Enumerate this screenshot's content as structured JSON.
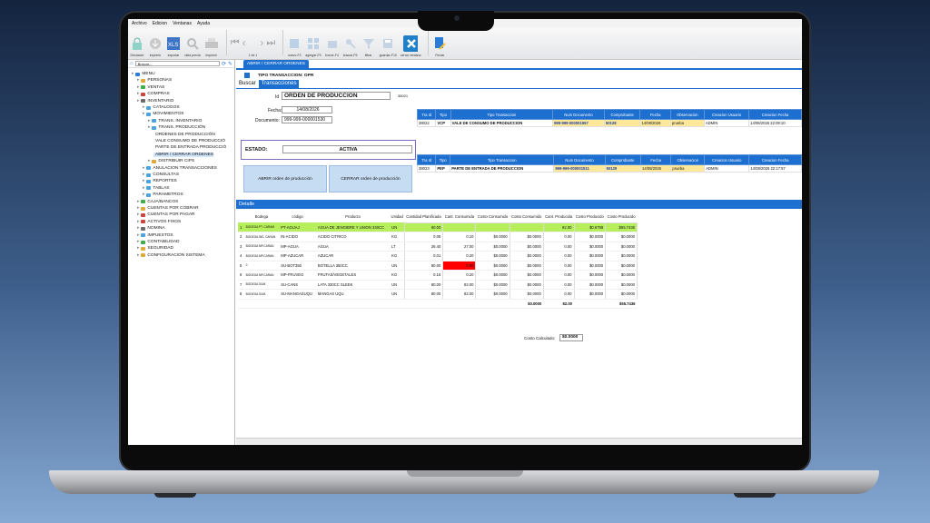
{
  "menu": [
    "Archivo",
    "Edicion",
    "Ventanas",
    "Ayuda"
  ],
  "toolbar": {
    "deshacer": "Deshacer",
    "imprimir": "imprimir",
    "exportar": "exportar",
    "vista_previa": "vista previa",
    "imprimir2": "imprimir",
    "page": "1 de 1",
    "nuevo": "nuevo-F2",
    "agregar": "agregar-F3",
    "borrar": "borrar-F4",
    "buscar": "buscar-F5",
    "filtrar": "filtrar",
    "guardar": "guardar-F10",
    "cerrar": "cerrar ventana",
    "firmar": "Firmar"
  },
  "search": {
    "placeholder": "Buscar..."
  },
  "tree": [
    {
      "label": "MENU",
      "depth": 0,
      "color": "#2b7bd8"
    },
    {
      "label": "PERSONAS",
      "depth": 1,
      "color": "#e0a93b"
    },
    {
      "label": "VENTAS",
      "depth": 1,
      "color": "#3fae4a"
    },
    {
      "label": "COMPRAS",
      "depth": 1,
      "color": "#c8463b"
    },
    {
      "label": "INVENTARIO",
      "depth": 1,
      "color": "#6b6b6b"
    },
    {
      "label": "CATALOGOS",
      "depth": 2,
      "color": "#4aa3df"
    },
    {
      "label": "MOVIMIENTOS",
      "depth": 2,
      "color": "#4aa3df"
    },
    {
      "label": "TRANS. INVENTARIO",
      "depth": 3,
      "color": "#4aa3df"
    },
    {
      "label": "TRANS. PRODUCCIÓN",
      "depth": 3,
      "color": "#4aa3df"
    },
    {
      "label": "ORDENES DE PRODUCCIÓN",
      "depth": 4,
      "color": ""
    },
    {
      "label": "VALE CONSUMO DE PRODUCCIÓ",
      "depth": 4,
      "color": ""
    },
    {
      "label": "PARTE DE ENTRADA PRODUCCIÓ",
      "depth": 4,
      "color": ""
    },
    {
      "label": "ABRIR / CERRAR ORDENES",
      "depth": 4,
      "color": "",
      "selected": true
    },
    {
      "label": "DISTRIBUIR CIPS",
      "depth": 3,
      "color": "#e0a93b"
    },
    {
      "label": "ANULACION TRANSACCIONES",
      "depth": 2,
      "color": "#4aa3df"
    },
    {
      "label": "CONSULTAS",
      "depth": 2,
      "color": "#4aa3df"
    },
    {
      "label": "REPORTES",
      "depth": 2,
      "color": "#4aa3df"
    },
    {
      "label": "TABLAS",
      "depth": 2,
      "color": "#4aa3df"
    },
    {
      "label": "PARAMETROS",
      "depth": 2,
      "color": "#4aa3df"
    },
    {
      "label": "CAJA/BANCOS",
      "depth": 1,
      "color": "#3fae4a"
    },
    {
      "label": "CUENTAS POR COBRAR",
      "depth": 1,
      "color": "#e0a93b"
    },
    {
      "label": "CUENTAS POR PAGAR",
      "depth": 1,
      "color": "#c8463b"
    },
    {
      "label": "ACTIVOS FIXOS",
      "depth": 1,
      "color": "#c8463b"
    },
    {
      "label": "NOMINA",
      "depth": 1,
      "color": "#6b6b6b"
    },
    {
      "label": "IMPUESTOS",
      "depth": 1,
      "color": "#4aa3df"
    },
    {
      "label": "CONTABILIDAD",
      "depth": 1,
      "color": "#3fae4a"
    },
    {
      "label": "SEGURIDAD",
      "depth": 1,
      "color": "#e0a93b"
    },
    {
      "label": "CONFIGURACION SISTEMA",
      "depth": 1,
      "color": "#e0a93b"
    }
  ],
  "doc_tab": "ABRIR / CERRAR ORDENES",
  "tipo_transaccion": "TIPO TRANSACCION: OPR",
  "tabs": {
    "buscar": "Buscar",
    "transacciones": "Transacciones"
  },
  "form": {
    "id_label": "Id",
    "id_value": "ORDEN DE PRODUCCION",
    "id_num": "38021",
    "fecha_label": "Fecha:",
    "fecha_value": "14/08/2026",
    "doc_label": "Documento:",
    "doc_value": "999-999-000001530",
    "estado_label": "ESTADO:",
    "estado_value": "ACTIVA",
    "abrir": "ABRIR orden de producción",
    "cerrar": "CERRAR orden de producción"
  },
  "trans_cols": [
    "Tra Id",
    "Tipo",
    "Tipo Transaccion",
    "Num Documento",
    "Comprobante",
    "Fecha",
    "Observacion",
    "Creacion Usuario",
    "Creacion Fecha"
  ],
  "grid1": [
    [
      "38022",
      "VCP",
      "VALE DE CONSUMO DE PRODUCCION",
      "999-999-000001557",
      "50128",
      "14/08/2026",
      "prueba",
      "ADMIN",
      "14/08/2026 22:09:10"
    ]
  ],
  "grid2": [
    [
      "38023",
      "PEP",
      "PARTE DE ENTRADA DE PRODUCCION",
      "999-999-000001511",
      "50129",
      "14/08/2026",
      "prueba",
      "ADMIN",
      "14/08/2026 22:17:57"
    ]
  ],
  "detalle": "Detalle",
  "det_cols": [
    "",
    "Bodega",
    "código",
    "Producto",
    "Unidad",
    "Cantidad Planificada",
    "Cant. Consumida",
    "Costo Consumido",
    "Costo Consumido",
    "Cant. Producida",
    "Costo Producido",
    "Costo Producido"
  ],
  "det_rows": [
    [
      "1",
      "BODEGA PT. CARAM",
      "PT-AGUAJ",
      "AGUA DE JENGIBRE Y LIMON 330CC",
      "UN",
      "80.00",
      "",
      "",
      "",
      "82.00",
      "$0.6798",
      "$55.7436"
    ],
    [
      "2",
      "BODEGA INS. CARAN",
      "IN-ACIDO",
      "ACIDO CITRICO",
      "KG",
      "0.08",
      "0.10",
      "$0.0000",
      "$0.0000",
      "0.00",
      "$0.0000",
      "$0.0000"
    ],
    [
      "3",
      "BODEGA MP.CARAN",
      "MP-AGUA",
      "AGUA",
      "LT",
      "26.40",
      "27.00",
      "$0.0000",
      "$0.0000",
      "0.00",
      "$0.0000",
      "$0.0000"
    ],
    [
      "4",
      "BODEGA MP.CARAN",
      "MP-AZUCAR",
      "AZUCAR",
      "KG",
      "0.01",
      "0.20",
      "$0.0000",
      "$0.0000",
      "0.00",
      "$0.0000",
      "$0.0000"
    ],
    [
      "5",
      "0",
      "SU-BOT350",
      "BOTELLA 350CC",
      "UN",
      "80.00",
      "0.00",
      "$0.0000",
      "$0.0000",
      "0.00",
      "$0.0000",
      "$0.0000"
    ],
    [
      "6",
      "BODEGA MP.CARAN",
      "MP-FRUVEG",
      "FRUTAS/VEGETALES",
      "KG",
      "0.16",
      "0.20",
      "$0.0000",
      "$0.0000",
      "0.00",
      "$0.0000",
      "$0.0000"
    ],
    [
      "7",
      "BODEGA SUM.",
      "SU-CANS",
      "LATA 330CC SLEEK",
      "UN",
      "80.00",
      "82.00",
      "$0.0000",
      "$0.0000",
      "0.00",
      "$0.0000",
      "$0.0000"
    ],
    [
      "8",
      "BODEGA SUM.",
      "SU-MANGASUQU",
      "MANGAS UQU",
      "UN",
      "80.00",
      "82.00",
      "$0.0000",
      "$0.0000",
      "0.00",
      "$0.0000",
      "$0.0000"
    ]
  ],
  "totals": {
    "costo_consumido": "$0.0000",
    "cant_producida": "82.00",
    "costo_producido": "$55.7436"
  },
  "costo_calculado_label": "Costo Calculado:",
  "costo_calculado_value": "$0.0000",
  "colors": {
    "accent": "#1d6fd0",
    "highlight_row": "#b7ef5c",
    "yellow": "#ffe89a",
    "alert": "#ff0000"
  }
}
